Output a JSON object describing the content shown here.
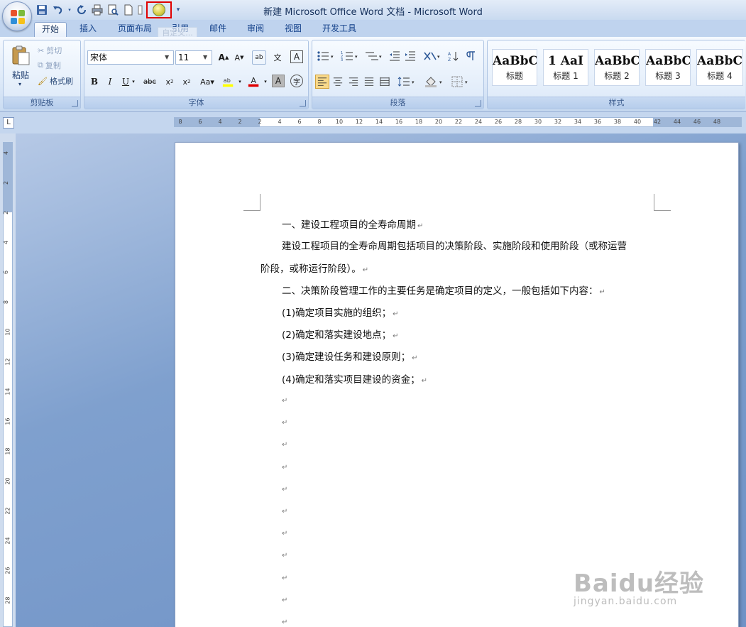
{
  "window": {
    "title": "新建 Microsoft Office Word 文档 - Microsoft Word"
  },
  "tabs": [
    {
      "label": "开始",
      "active": true
    },
    {
      "label": "插入"
    },
    {
      "label": "页面布局"
    },
    {
      "label": "引用"
    },
    {
      "label": "邮件"
    },
    {
      "label": "审阅"
    },
    {
      "label": "视图"
    },
    {
      "label": "开发工具"
    }
  ],
  "tooltip": "自定义...",
  "clipboard": {
    "label": "剪贴板",
    "paste": "粘贴",
    "cut": "剪切",
    "copy": "复制",
    "format_painter": "格式刷"
  },
  "font": {
    "label": "字体",
    "family": "宋体",
    "size": "11"
  },
  "paragraph": {
    "label": "段落"
  },
  "styles": {
    "label": "样式",
    "items": [
      {
        "sample": "AaBbC",
        "name": "标题"
      },
      {
        "sample": "1  AaI",
        "name": "标题 1"
      },
      {
        "sample": "AaBbC",
        "name": "标题 2"
      },
      {
        "sample": "AaBbC",
        "name": "标题 3"
      },
      {
        "sample": "AaBbC",
        "name": "标题 4"
      }
    ]
  },
  "ruler": {
    "ticks": [
      "8",
      "6",
      "4",
      "2",
      "2",
      "4",
      "6",
      "8",
      "10",
      "12",
      "14",
      "16",
      "18",
      "20",
      "22",
      "24",
      "26",
      "28",
      "30",
      "32",
      "34",
      "36",
      "38",
      "40",
      "42",
      "44",
      "46",
      "48"
    ],
    "vticks": [
      "4",
      "2",
      "2",
      "4",
      "6",
      "8",
      "10",
      "12",
      "14",
      "16",
      "18",
      "20",
      "22",
      "24",
      "26",
      "28"
    ]
  },
  "document": {
    "paragraphs": [
      "一、建设工程项目的全寿命周期",
      "建设工程项目的全寿命周期包括项目的决策阶段、实施阶段和使用阶段（或称运营",
      "阶段，或称运行阶段）。",
      "二、决策阶段管理工作的主要任务是确定项目的定义，一般包括如下内容：",
      "(1)确定项目实施的组织；",
      "(2)确定和落实建设地点；",
      "(3)确定建设任务和建设原则；",
      "(4)确定和落实项目建设的资金；"
    ],
    "paragraph_mark": "↵",
    "empty_lines": 11
  },
  "watermark": {
    "main": "Baidu经验",
    "sub": "jingyan.baidu.com"
  }
}
